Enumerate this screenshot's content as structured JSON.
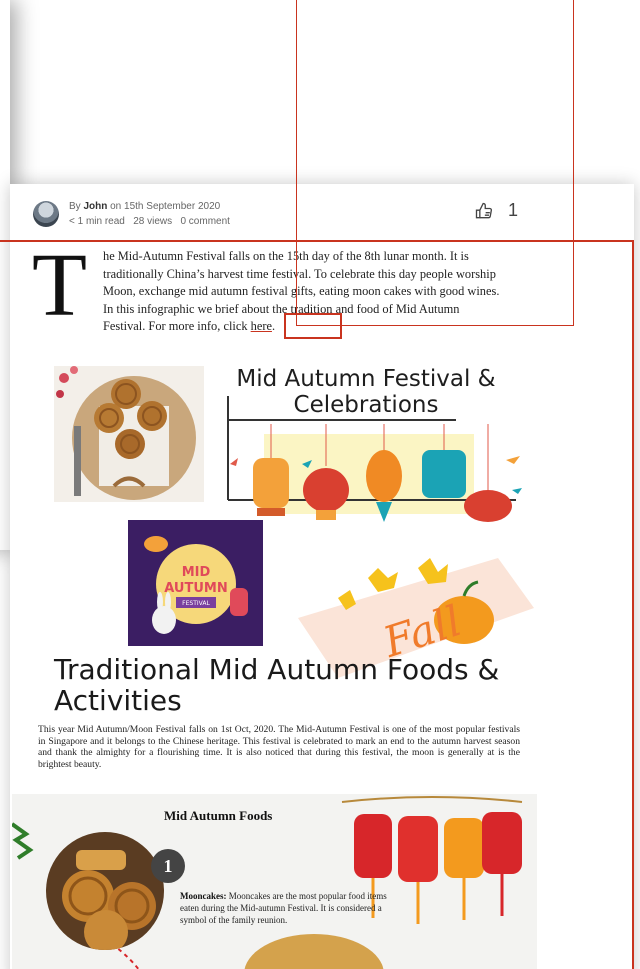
{
  "meta": {
    "by_prefix": "By",
    "author": "John",
    "date_text": "on 15th September 2020",
    "read_time": "< 1 min read",
    "views": "28 views",
    "comments": "0 comment",
    "likes": "1"
  },
  "article": {
    "dropcap": "T",
    "intro_before_link": "he Mid-Autumn Festival falls on the 15th day of the 8th lunar month. It is traditionally China’s harvest time festival. To celebrate this day people worship Moon, exchange mid autumn festival gifts, eating moon cakes with good wines. In this infographic we brief about the tradition and food of Mid Autumn Festival. For more info, click ",
    "link_text": "here",
    "intro_after_link": "."
  },
  "infographic": {
    "title": "Mid Autumn Festival & Celebrations",
    "poster_lines": [
      "MID",
      "AUTUMN",
      "FESTIVAL"
    ],
    "fall_word": "Fall",
    "foods_title": "Traditional Mid Autumn Foods & Activities",
    "foods_desc": "This year Mid Autumn/Moon Festival falls on 1st Oct, 2020. The Mid-Autumn Festival is one of the most popular festivals in Singapore and it belongs to the Chinese heritage. This festival is celebrated to mark an end to the autumn harvest season and thank the almighty for a flourishing time. It is also noticed that during this festival, the moon is generally at is the brightest beauty.",
    "panel_title": "Mid Autumn Foods",
    "item_number": "1",
    "mooncakes_label": "Mooncakes:",
    "mooncakes_text": " Mooncakes are the most popular food items eaten during the Mid-autumn Festival. It is considered a symbol of the family reunion."
  },
  "colors": {
    "highlight": "#c9341f",
    "poster_bg": "#3b1e63",
    "lantern_red": "#d7262a",
    "lantern_orange": "#f39a1e",
    "lantern_teal": "#1ba3b5"
  },
  "icons": {
    "like": "thumbs-up-icon",
    "avatar": "user-avatar"
  }
}
